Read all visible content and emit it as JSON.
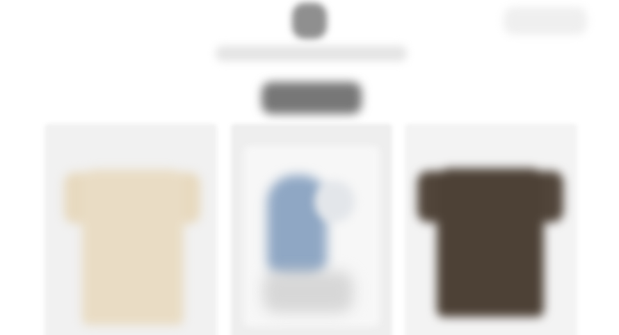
{
  "header": {
    "logo_icon": "brand-logo-icon",
    "tagline": "",
    "account_label": ""
  },
  "collection": {
    "heading": ""
  },
  "products": [
    {
      "name": "",
      "color": "#e9dcc4",
      "image_type": "tshirt-beige"
    },
    {
      "name": "",
      "color": "#8fa7c4",
      "image_type": "figure-photo"
    },
    {
      "name": "",
      "color": "#4d4136",
      "image_type": "tshirt-brown"
    }
  ],
  "colors": {
    "background": "#ffffff",
    "card_background": "#f1f1f1",
    "heading": "#777777"
  }
}
